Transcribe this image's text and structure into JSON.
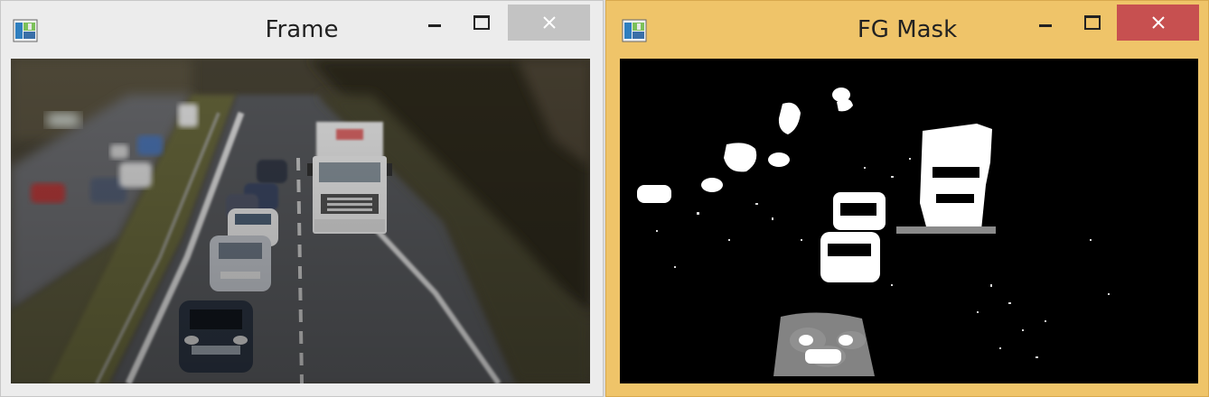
{
  "windows": {
    "frame": {
      "title": "Frame",
      "content": "video-frame-highway"
    },
    "mask": {
      "title": "FG Mask",
      "content": "foreground-mask"
    }
  },
  "colors": {
    "inactive_title_bg": "#ececec",
    "active_title_bg": "#efc469",
    "inactive_close_bg": "#c3c3c3",
    "active_close_bg": "#c75050"
  },
  "icons": {
    "app": "opencv-window-icon",
    "minimize": "minimize-icon",
    "maximize": "maximize-icon",
    "close": "close-icon"
  }
}
